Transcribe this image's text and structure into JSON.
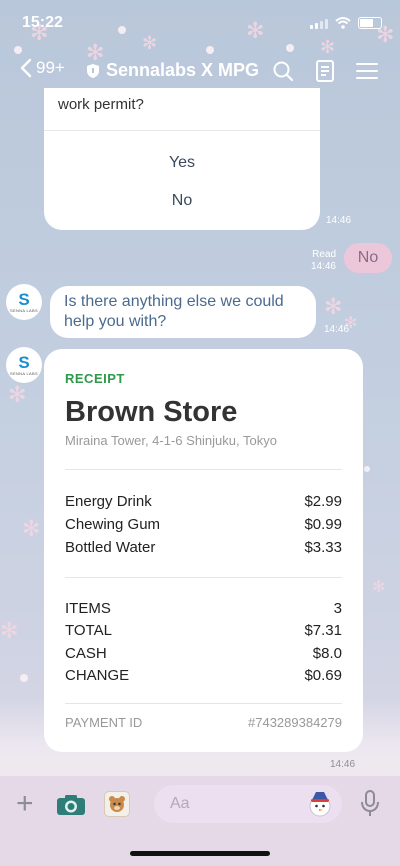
{
  "status_bar": {
    "time": "15:22"
  },
  "header": {
    "back_label": "99+",
    "chat_name": "Sennalabs X MPG",
    "icons": [
      "chevron-left-icon",
      "shield-icon",
      "search-icon",
      "notes-icon",
      "menu-icon"
    ]
  },
  "messages": {
    "question_card": {
      "text": "work permit?",
      "options": [
        "Yes",
        "No"
      ],
      "time": "14:46"
    },
    "user_reply": {
      "read_label": "Read",
      "time": "14:46",
      "text": "No"
    },
    "bot_message": {
      "avatar_letter": "S",
      "avatar_label": "SENNA LABS",
      "text": "Is there anything else we could help you with?",
      "time": "14:46"
    },
    "receipt": {
      "avatar_letter": "S",
      "avatar_label": "SENNA LABS",
      "kind": "RECEIPT",
      "store": "Brown Store",
      "address": "Miraina Tower, 4-1-6 Shinjuku, Tokyo",
      "items": [
        {
          "name": "Energy Drink",
          "price": "$2.99"
        },
        {
          "name": "Chewing Gum",
          "price": "$0.99"
        },
        {
          "name": "Bottled Water",
          "price": "$3.33"
        }
      ],
      "summary": [
        {
          "label": "ITEMS",
          "value": "3"
        },
        {
          "label": "TOTAL",
          "value": "$7.31"
        },
        {
          "label": "CASH",
          "value": "$8.0"
        },
        {
          "label": "CHANGE",
          "value": "$0.69"
        }
      ],
      "payment_label": "PAYMENT ID",
      "payment_id": "#743289384279",
      "time": "14:46"
    }
  },
  "input_bar": {
    "placeholder": "Aa",
    "icons": [
      "plus-icon",
      "camera-icon",
      "sticker-icon",
      "emoji-icon",
      "mic-icon"
    ]
  },
  "colors": {
    "accent_green": "#2e9a4a",
    "reply_bubble": "#ecc7d9",
    "input_bar": "#e5d9e7"
  }
}
